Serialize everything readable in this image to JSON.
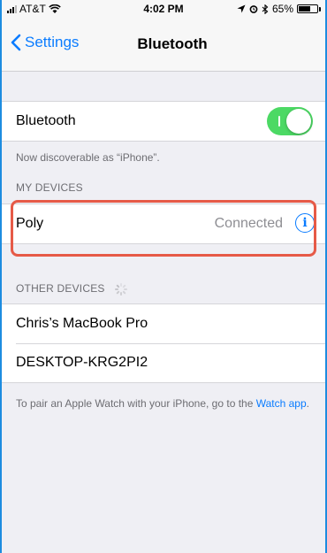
{
  "status_bar": {
    "carrier": "AT&T",
    "time": "4:02 PM",
    "battery_percent": "65%",
    "battery_level": 0.65,
    "icons": [
      "signal-icon",
      "wifi-icon",
      "location-icon",
      "alarm-icon",
      "bluetooth-icon",
      "battery-icon"
    ]
  },
  "nav": {
    "back_label": "Settings",
    "title": "Bluetooth"
  },
  "bluetooth_toggle": {
    "label": "Bluetooth",
    "on": true
  },
  "discoverable_note": "Now discoverable as “iPhone”.",
  "my_devices": {
    "header": "MY DEVICES",
    "items": [
      {
        "name": "Poly",
        "status": "Connected"
      }
    ]
  },
  "other_devices": {
    "header": "OTHER DEVICES",
    "items": [
      {
        "name": "Chris’s MacBook Pro"
      },
      {
        "name": "DESKTOP-KRG2PI2"
      }
    ]
  },
  "footer": {
    "text": "To pair an Apple Watch with your iPhone, go to the",
    "link": "Watch app",
    "end": "."
  },
  "colors": {
    "accent": "#0a7cff",
    "toggle_on": "#4cd964",
    "highlight": "#e65a47",
    "frame": "#1d8ce0"
  }
}
